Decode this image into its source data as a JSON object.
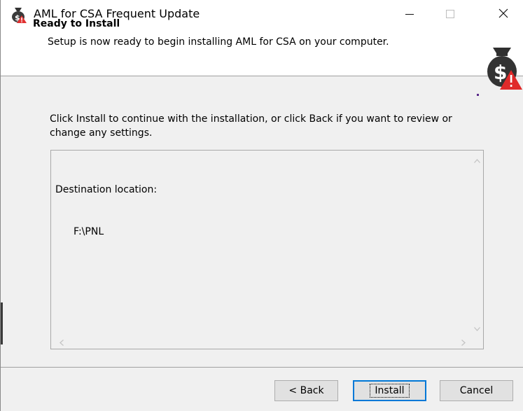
{
  "window": {
    "title": "AML for CSA Frequent Update",
    "app_icon": "money-bag-warning-icon",
    "controls": [
      "minimize-icon",
      "maximize-icon",
      "close-icon"
    ]
  },
  "header": {
    "title": "Ready to Install",
    "subtitle": "Setup is now ready to begin installing AML for CSA on your computer.",
    "icon": "money-bag-warning-icon"
  },
  "body": {
    "instruction": "Click Install to continue with the installation, or click Back if you want to review or change any settings.",
    "memo": {
      "line1": "Destination location:",
      "line2": "F:\\PNL"
    }
  },
  "buttons": {
    "back": "< Back",
    "install": "Install",
    "cancel": "Cancel"
  },
  "colors": {
    "accent": "#0078d7",
    "background": "#f0f0f0",
    "header_bg": "#ffffff"
  }
}
